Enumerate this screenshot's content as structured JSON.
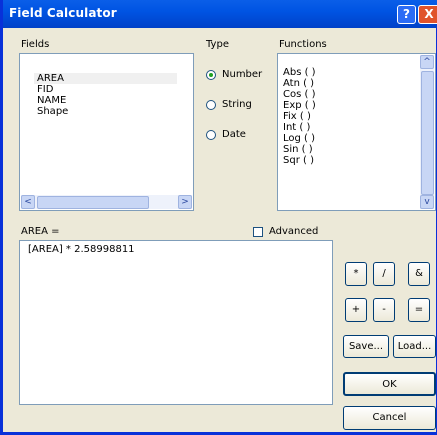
{
  "window": {
    "title": "Field Calculator",
    "help_glyph": "?",
    "close_glyph": "X"
  },
  "fields": {
    "label": "Fields",
    "items": [
      "AREA",
      "FID",
      "NAME",
      "Shape"
    ],
    "selected": "AREA"
  },
  "type": {
    "label": "Type",
    "options": [
      "Number",
      "String",
      "Date"
    ],
    "selected": "Number"
  },
  "functions": {
    "label": "Functions",
    "items": [
      "Abs ( )",
      "Atn ( )",
      "Cos ( )",
      "Exp ( )",
      "Fix ( )",
      "Int ( )",
      "Log ( )",
      "Sin ( )",
      "Sqr ( )"
    ]
  },
  "expression": {
    "label": "AREA =",
    "value": "[AREA] * 2.58998811"
  },
  "advanced": {
    "label": "Advanced",
    "checked": false
  },
  "operators": {
    "row1": [
      "*",
      "/",
      "&"
    ],
    "row2": [
      "+",
      "-",
      "="
    ]
  },
  "buttons": {
    "save": "Save...",
    "load": "Load...",
    "ok": "OK",
    "cancel": "Cancel"
  },
  "scroll_glyphs": {
    "left": "<",
    "right": ">",
    "up": "^",
    "down": "v"
  }
}
